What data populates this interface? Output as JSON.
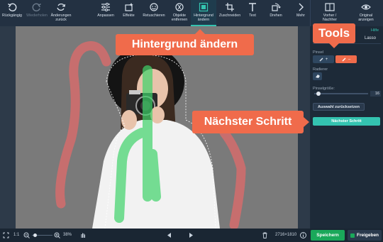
{
  "toolbar": {
    "undo_label": "Rückgängig",
    "redo_label": "Wiederholen",
    "discard_label_1": "Änderungen",
    "discard_label_2": "zurück",
    "adjust_label": "Anpassen",
    "effects_label": "Effekte",
    "retouch_label": "Retuschieren",
    "remove_label_1": "Objekte",
    "remove_label_2": "entfernen",
    "bg_label_1": "Hintergrund",
    "bg_label_2": "ändern",
    "crop_label": "Zuschneiden",
    "text_label": "Text",
    "rotate_label": "Drehen",
    "more_label": "Mehr",
    "before_after_label_1": "Vorher /",
    "before_after_label_2": "Nachher",
    "original_label_1": "Original",
    "original_label_2": "anzeigen"
  },
  "callouts": {
    "tools": "Tools",
    "change_bg": "Hintergrund ändern",
    "next_step": "Nächster Schritt"
  },
  "panel": {
    "help_link": "Hilfe",
    "lasso_tab": "Lasso",
    "brush_label": "Pinsel",
    "brush_add": "+",
    "brush_remove": "–",
    "eraser_label": "Radierer",
    "brush_size_label": "Pinselgröße:",
    "brush_size_value": "16",
    "reset_selection_button": "Auswahl zurücksetzen",
    "next_step_button": "Nächster Schritt"
  },
  "bottom": {
    "fit_label": "1:1",
    "zoom_value": "38%",
    "image_size": "2716×1810",
    "save_button": "Speichern",
    "share_button": "Freigeben"
  },
  "colors": {
    "accent": "#34c3b0",
    "callout": "#f06b4b",
    "save_green": "#1aa85a",
    "background_stroke": "#e26b6b",
    "foreground_stroke": "#3fd36a"
  }
}
